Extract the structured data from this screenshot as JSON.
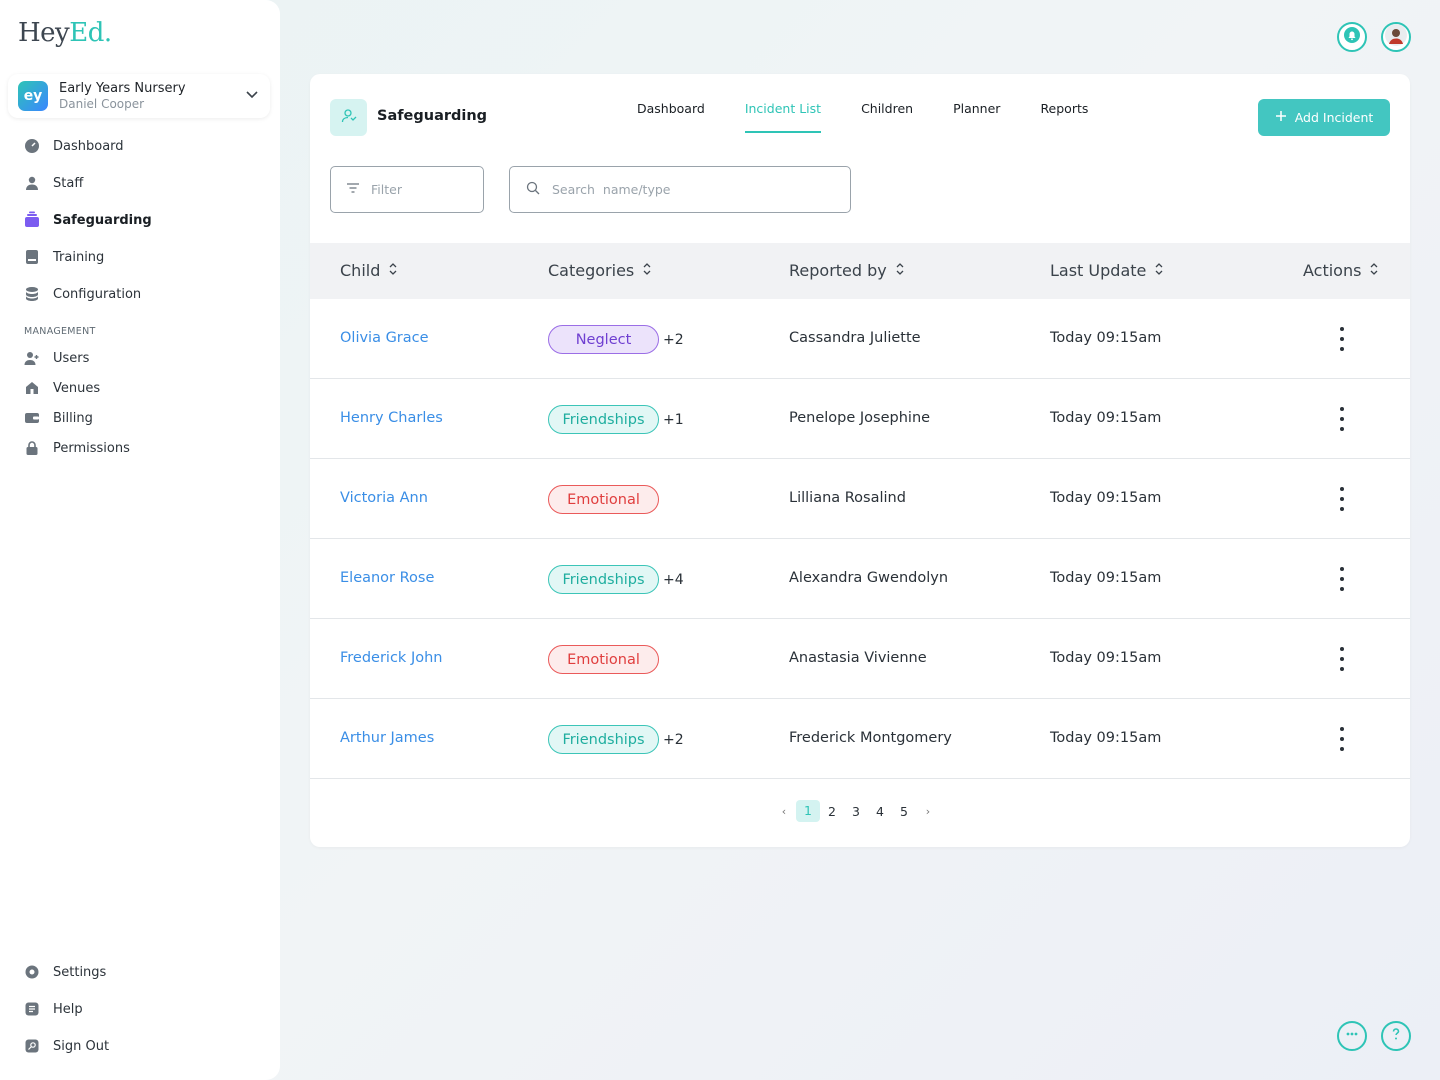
{
  "brand": {
    "logo_main": "Hey",
    "logo_accent": "Ed."
  },
  "org": {
    "name": "Early Years Nursery",
    "user": "Daniel Cooper",
    "logo_letters": "ey"
  },
  "nav": {
    "items": [
      {
        "label": "Dashboard",
        "icon": "dashboard-icon"
      },
      {
        "label": "Staff",
        "icon": "person-icon"
      },
      {
        "label": "Safeguarding",
        "icon": "safeguarding-icon",
        "active": true
      },
      {
        "label": "Training",
        "icon": "training-icon"
      },
      {
        "label": "Configuration",
        "icon": "database-icon"
      }
    ],
    "management_label": "MANAGEMENT",
    "management": [
      {
        "label": "Users",
        "icon": "add-user-icon"
      },
      {
        "label": "Venues",
        "icon": "home-icon"
      },
      {
        "label": "Billing",
        "icon": "wallet-icon"
      },
      {
        "label": "Permissions",
        "icon": "lock-icon"
      }
    ],
    "footer": [
      {
        "label": "Settings",
        "icon": "gear-icon"
      },
      {
        "label": "Help",
        "icon": "help-icon"
      },
      {
        "label": "Sign Out",
        "icon": "signout-icon"
      }
    ]
  },
  "module": {
    "title": "Safeguarding"
  },
  "tabs": [
    {
      "label": "Dashboard"
    },
    {
      "label": "Incident List",
      "active": true
    },
    {
      "label": "Children"
    },
    {
      "label": "Planner"
    },
    {
      "label": "Reports"
    }
  ],
  "add_button": {
    "label": "Add Incident"
  },
  "filter": {
    "placeholder": "Filter"
  },
  "search": {
    "placeholder": "Search  name/type"
  },
  "table": {
    "headers": [
      "Child",
      "Categories",
      "Reported by",
      "Last Update",
      "Actions"
    ],
    "rows": [
      {
        "child": "Olivia Grace",
        "category": "Neglect",
        "category_color": "purple",
        "extra": "+2",
        "reported_by": "Cassandra Juliette",
        "last_update": "Today 09:15am"
      },
      {
        "child": "Henry Charles",
        "category": "Friendships",
        "category_color": "teal",
        "extra": "+1",
        "reported_by": "Penelope Josephine",
        "last_update": "Today 09:15am"
      },
      {
        "child": "Victoria Ann",
        "category": "Emotional",
        "category_color": "red",
        "extra": "",
        "reported_by": "Lilliana Rosalind",
        "last_update": "Today 09:15am"
      },
      {
        "child": "Eleanor Rose",
        "category": "Friendships",
        "category_color": "teal",
        "extra": "+4",
        "reported_by": "Alexandra Gwendolyn",
        "last_update": "Today 09:15am"
      },
      {
        "child": "Frederick John",
        "category": "Emotional",
        "category_color": "red",
        "extra": "",
        "reported_by": "Anastasia Vivienne",
        "last_update": "Today 09:15am"
      },
      {
        "child": "Arthur James",
        "category": "Friendships",
        "category_color": "teal",
        "extra": "+2",
        "reported_by": "Frederick Montgomery",
        "last_update": "Today 09:15am"
      }
    ]
  },
  "pagination": {
    "pages": [
      "1",
      "2",
      "3",
      "4",
      "5"
    ],
    "current": "1",
    "prev": "‹",
    "next": "›"
  },
  "colors": {
    "accent": "#2ec4b6",
    "link": "#3a8ee6",
    "button": "#43c6c1"
  }
}
